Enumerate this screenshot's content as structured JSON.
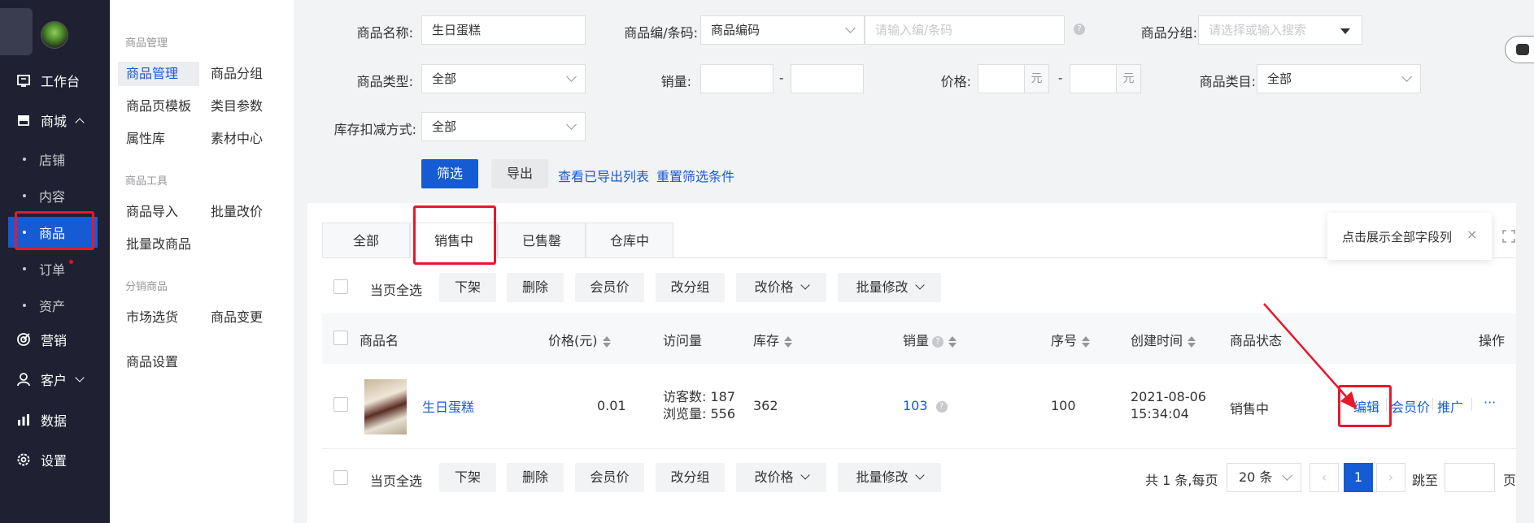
{
  "nav": {
    "items": [
      {
        "label": "工作台",
        "icon": "workbench-icon"
      },
      {
        "label": "商城",
        "icon": "shop-icon"
      },
      {
        "label": "营销",
        "icon": "marketing-icon"
      },
      {
        "label": "客户",
        "icon": "customer-icon"
      },
      {
        "label": "数据",
        "icon": "data-icon"
      },
      {
        "label": "设置",
        "icon": "settings-icon"
      }
    ],
    "sub_items": [
      "店铺",
      "内容",
      "商品",
      "订单",
      "资产"
    ]
  },
  "subnav": {
    "group1": "商品管理",
    "items1": [
      "商品管理",
      "商品分组",
      "商品页模板",
      "类目参数",
      "属性库",
      "素材中心"
    ],
    "group2": "商品工具",
    "items2": [
      "商品导入",
      "批量改价",
      "批量改商品"
    ],
    "group3": "分销商品",
    "items3": [
      "市场选货",
      "商品变更"
    ],
    "settings": "商品设置"
  },
  "filter": {
    "name_label": "商品名称:",
    "name_value": "生日蛋糕",
    "code_label": "商品编/条码:",
    "code_type": "商品编码",
    "code_placeholder": "请输入编/条码",
    "group_label": "商品分组:",
    "group_placeholder": "请选择或输入搜索",
    "type_label": "商品类型:",
    "type_value": "全部",
    "sales_label": "销量:",
    "price_label": "价格:",
    "price_unit": "元",
    "dash": "-",
    "category_label": "商品类目:",
    "category_value": "全部",
    "stock_label": "库存扣减方式:",
    "stock_value": "全部",
    "filter_btn": "筛选",
    "export_btn": "导出",
    "view_exports": "查看已导出列表",
    "reset": "重置筛选条件"
  },
  "tabs": [
    "全部",
    "销售中",
    "已售罄",
    "仓库中"
  ],
  "tooltip": "点击展示全部字段列",
  "actions": {
    "select_all": "当页全选",
    "off_shelf": "下架",
    "delete": "删除",
    "member_price": "会员价",
    "change_group": "改分组",
    "change_price": "改价格",
    "batch_edit": "批量修改"
  },
  "table": {
    "headers": [
      "商品名",
      "价格(元)",
      "访问量",
      "库存",
      "销量",
      "序号",
      "创建时间",
      "商品状态",
      "操作"
    ],
    "row": {
      "name": "生日蛋糕",
      "price": "0.01",
      "visitors": "访客数: 187",
      "views": "浏览量: 556",
      "stock": "362",
      "sales": "103",
      "seq": "100",
      "date": "2021-08-06",
      "time": "15:34:04",
      "status": "销售中",
      "ops": [
        "编辑",
        "会员价",
        "推广",
        "···"
      ]
    }
  },
  "pagination": {
    "total": "共 1 条,每页",
    "per_page": "20 条",
    "current": "1",
    "jump": "跳至",
    "page_suffix": "页"
  },
  "colors": {
    "primary": "#155bd4",
    "sidebar": "#1f2132",
    "highlight": "#e8182c"
  }
}
